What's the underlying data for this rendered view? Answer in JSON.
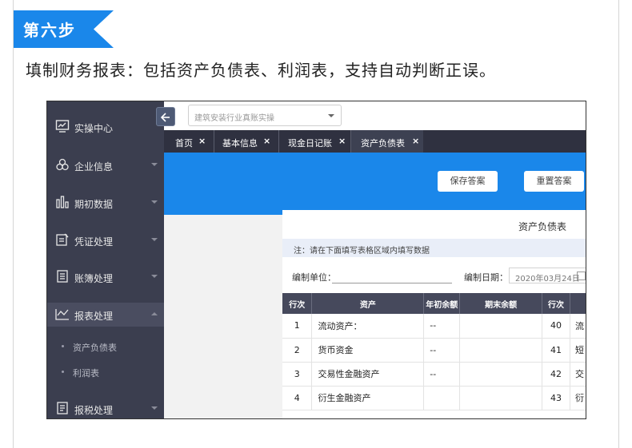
{
  "step": {
    "label": "第六步",
    "color": "#1a87ea"
  },
  "subtitle": "填制财务报表：包括资产负债表、利润表，支持自动判断正误。",
  "app": {
    "sidebar": {
      "items": [
        {
          "label": "实操中心",
          "icon": "chart-screen-icon"
        },
        {
          "label": "企业信息",
          "icon": "people-icon"
        },
        {
          "label": "期初数据",
          "icon": "bar-chart-icon"
        },
        {
          "label": "凭证处理",
          "icon": "document-edit-icon"
        },
        {
          "label": "账簿处理",
          "icon": "ledger-icon"
        },
        {
          "label": "报表处理",
          "icon": "line-chart-icon"
        },
        {
          "label": "报税处理",
          "icon": "tax-document-icon"
        }
      ],
      "subitems": [
        "资产负债表",
        "利润表"
      ]
    },
    "top_select": {
      "value": "建筑安装行业真账实操"
    },
    "tabs": [
      "首页",
      "基本信息",
      "现金日记账",
      "资产负债表"
    ],
    "tab_close": "×",
    "buttons": {
      "save": "保存答案",
      "reset": "重置答案"
    },
    "sheet_title": "资产负债表",
    "notice": "注：请在下面填写表格区域内填写数据",
    "meta": {
      "unit_label": "编制单位：",
      "date_label": "编制日期：",
      "date_value": "2020年03月24日"
    },
    "table": {
      "headers": [
        "行次",
        "资产",
        "年初余额",
        "期末余额",
        "行次",
        ""
      ],
      "rows": [
        [
          "1",
          "流动资产：",
          "--",
          "",
          "40",
          "流"
        ],
        [
          "2",
          "货币资金",
          "--",
          "",
          "41",
          "短"
        ],
        [
          "3",
          "交易性金融资产",
          "--",
          "",
          "42",
          "交"
        ],
        [
          "4",
          "衍生金融资产",
          "",
          "",
          "43",
          "衍"
        ]
      ]
    }
  }
}
